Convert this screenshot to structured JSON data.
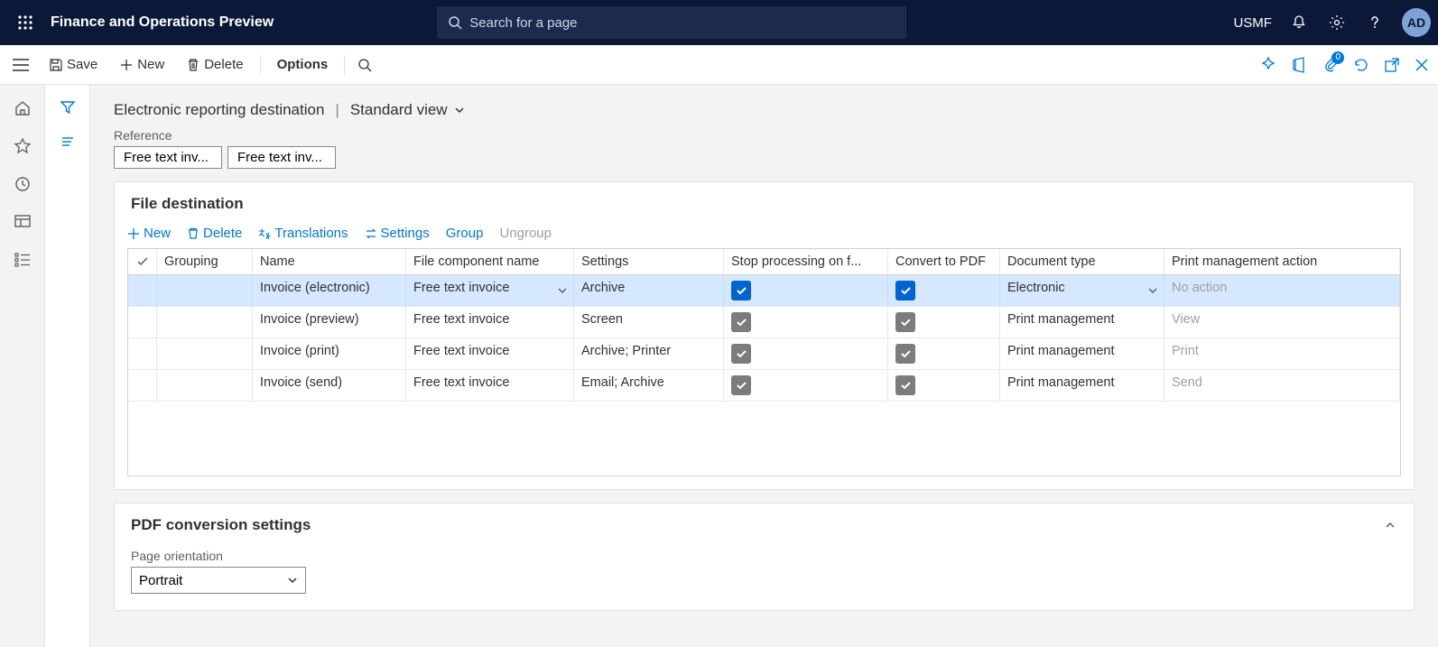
{
  "header": {
    "app_title": "Finance and Operations Preview",
    "search_placeholder": "Search for a page",
    "legal_entity": "USMF",
    "avatar_initials": "AD",
    "attach_badge": "0"
  },
  "commands": {
    "save": "Save",
    "new": "New",
    "delete": "Delete",
    "options": "Options"
  },
  "page": {
    "title": "Electronic reporting destination",
    "view_label": "Standard view"
  },
  "reference": {
    "label": "Reference",
    "values": [
      "Free text inv...",
      "Free text inv..."
    ]
  },
  "file_destination": {
    "title": "File destination",
    "toolbar": {
      "new": "New",
      "delete": "Delete",
      "translations": "Translations",
      "settings": "Settings",
      "group": "Group",
      "ungroup": "Ungroup"
    },
    "columns": {
      "grouping": "Grouping",
      "name": "Name",
      "file_component": "File component name",
      "settings": "Settings",
      "stop": "Stop processing on f...",
      "convert_pdf": "Convert to PDF",
      "doc_type": "Document type",
      "action": "Print management action"
    },
    "rows": [
      {
        "group": "",
        "name": "Invoice (electronic)",
        "file": "Free text invoice",
        "settings": "Archive",
        "stop": true,
        "stop_blue": true,
        "pdf": true,
        "pdf_blue": true,
        "doc": "Electronic",
        "action": "No action",
        "action_muted": true,
        "selected": true,
        "show_dd": true
      },
      {
        "group": "",
        "name": "Invoice (preview)",
        "file": "Free text invoice",
        "settings": "Screen",
        "stop": true,
        "stop_blue": false,
        "pdf": true,
        "pdf_blue": false,
        "doc": "Print management",
        "action": "View",
        "action_muted": true,
        "selected": false,
        "show_dd": false
      },
      {
        "group": "",
        "name": "Invoice (print)",
        "file": "Free text invoice",
        "settings": "Archive; Printer",
        "stop": true,
        "stop_blue": false,
        "pdf": true,
        "pdf_blue": false,
        "doc": "Print management",
        "action": "Print",
        "action_muted": true,
        "selected": false,
        "show_dd": false
      },
      {
        "group": "",
        "name": "Invoice (send)",
        "file": "Free text invoice",
        "settings": "Email; Archive",
        "stop": true,
        "stop_blue": false,
        "pdf": true,
        "pdf_blue": false,
        "doc": "Print management",
        "action": "Send",
        "action_muted": true,
        "selected": false,
        "show_dd": false
      }
    ]
  },
  "pdf_settings": {
    "title": "PDF conversion settings",
    "orientation_label": "Page orientation",
    "orientation_value": "Portrait"
  }
}
